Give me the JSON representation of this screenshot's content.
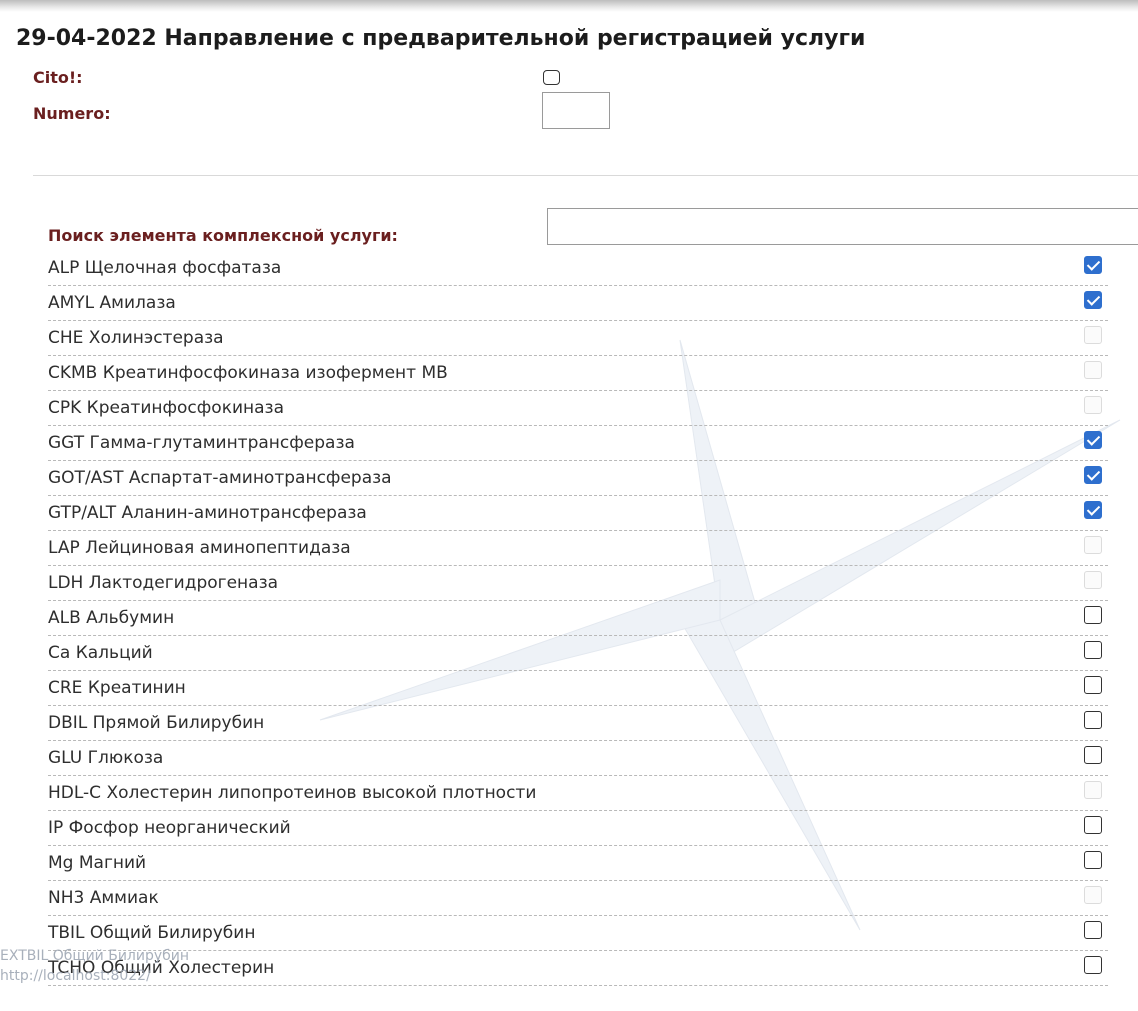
{
  "page": {
    "title": "29-04-2022 Направление с предварительной регистрацией услуги"
  },
  "form": {
    "cito_label": "Cito!:",
    "cito_checked": false,
    "numero_label": "Numero:",
    "numero_value": "",
    "search_label": "Поиск элемента комплексной услуги:",
    "search_value": ""
  },
  "items": [
    {
      "label": "ALP Щелочная фосфатаза",
      "state": "checked"
    },
    {
      "label": "AMYL Амилаза",
      "state": "checked"
    },
    {
      "label": "CHE Холинэстераза",
      "state": "disabled"
    },
    {
      "label": "CKMB Креатинфосфокиназа изофермент MB",
      "state": "disabled"
    },
    {
      "label": "CPK Креатинфосфокиназа",
      "state": "disabled"
    },
    {
      "label": "GGT Гамма-глутаминтрансфераза",
      "state": "checked"
    },
    {
      "label": "GOT/AST Аспартат-аминотрансфераза",
      "state": "checked"
    },
    {
      "label": "GTP/ALT Аланин-аминотрансфераза",
      "state": "checked"
    },
    {
      "label": "LAP Лейциновая аминопептидаза",
      "state": "disabled"
    },
    {
      "label": "LDH Лактодегидрогеназа",
      "state": "disabled"
    },
    {
      "label": "ALB Альбумин",
      "state": "unchecked"
    },
    {
      "label": "Ca Кальций",
      "state": "unchecked"
    },
    {
      "label": "CRE Креатинин",
      "state": "unchecked"
    },
    {
      "label": "DBIL Прямой Билирубин",
      "state": "unchecked"
    },
    {
      "label": "GLU Глюкоза",
      "state": "unchecked"
    },
    {
      "label": "HDL-C Холестерин липопротеинов высокой плотности",
      "state": "disabled"
    },
    {
      "label": "IP Фосфор неорганический",
      "state": "unchecked"
    },
    {
      "label": "Mg Магний",
      "state": "unchecked"
    },
    {
      "label": "NH3 Аммиак",
      "state": "disabled"
    },
    {
      "label": "TBIL Общий Билирубин",
      "state": "unchecked"
    },
    {
      "label": "TCHO Общий Холестерин",
      "state": "unchecked"
    }
  ],
  "overlay": {
    "line1": "EXTBIL Общий Билирубин",
    "line2": "http://localhost:8022/"
  },
  "colors": {
    "label_red": "#6a1f1f",
    "checkbox_blue": "#2e6fce"
  }
}
